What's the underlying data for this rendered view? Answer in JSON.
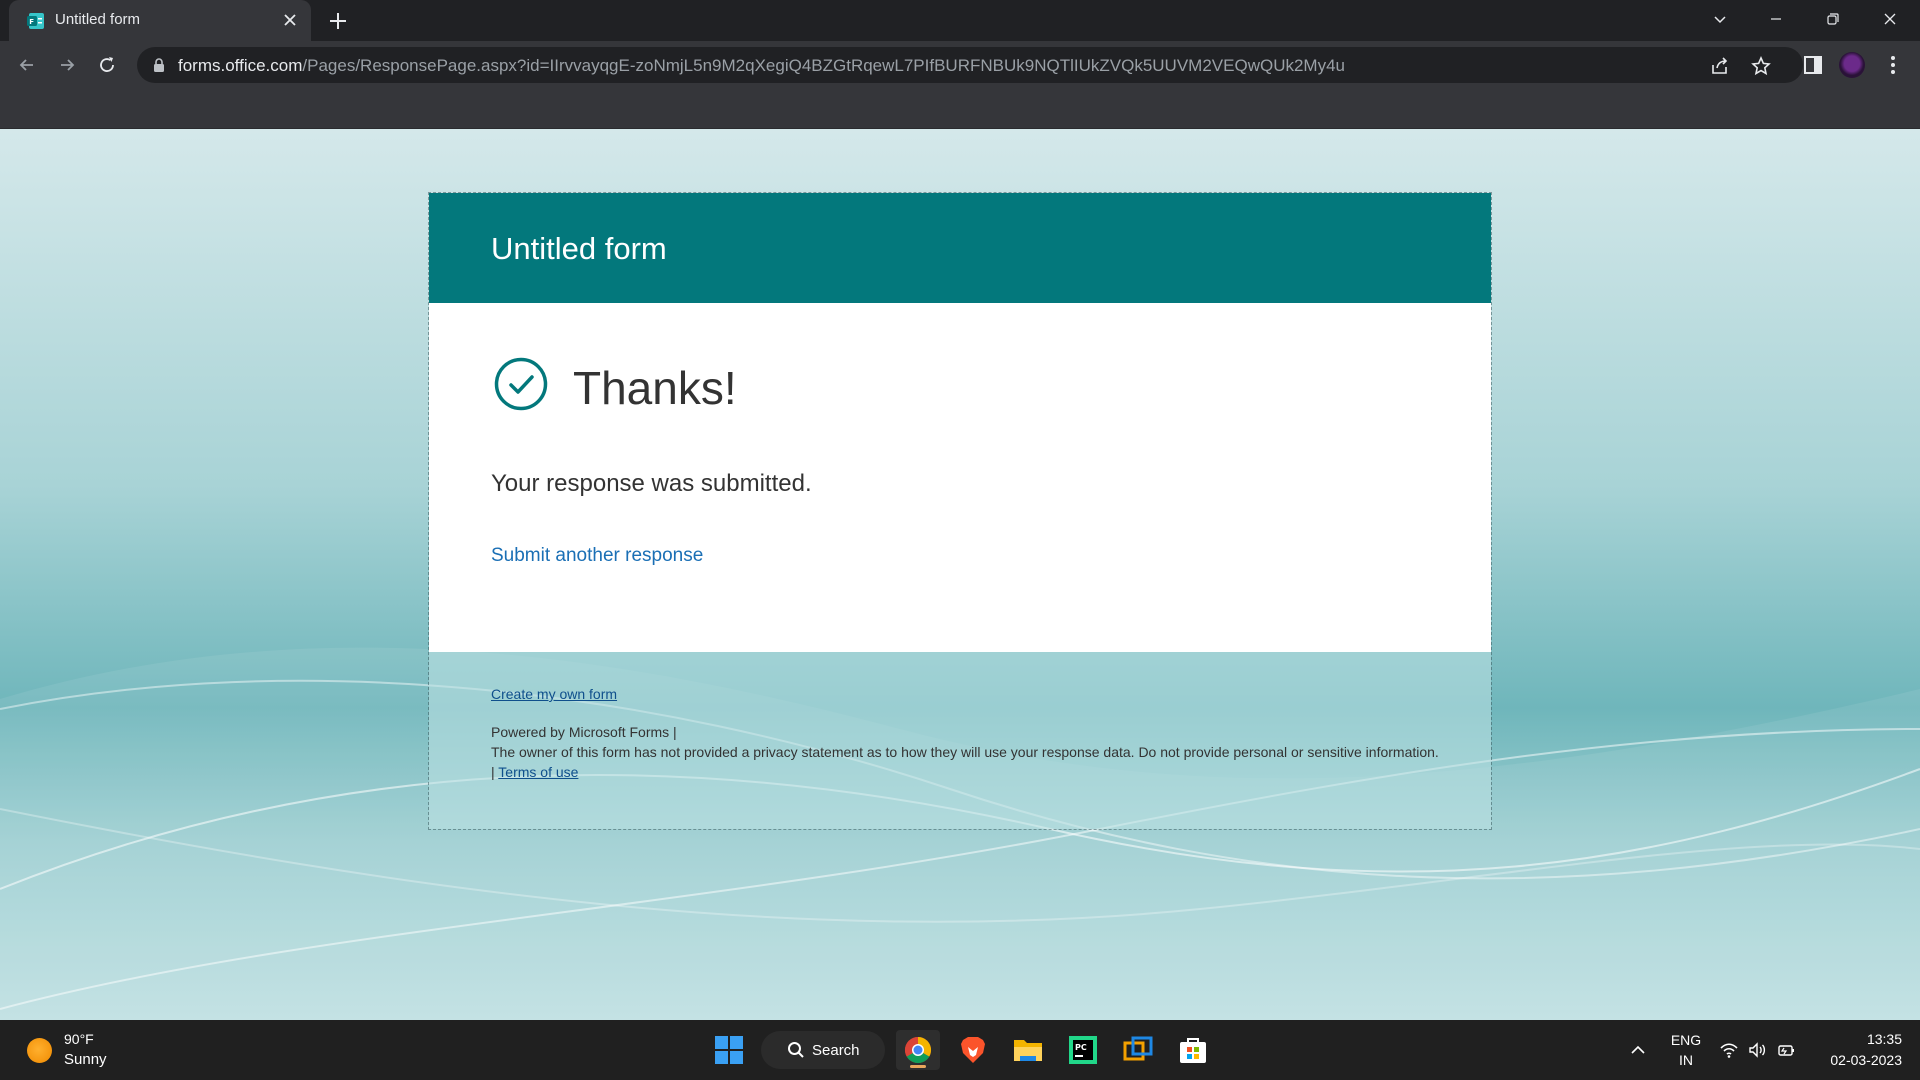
{
  "browser": {
    "tab_title": "Untitled form",
    "url_host": "forms.office.com",
    "url_path": "/Pages/ResponsePage.aspx?id=IIrvvayqgE-zoNmjL5n9M2qXegiQ4BZGtRqewL7PIfBURFNBUk9NQTlIUkZVQk5UUVM2VEQwQUk2My4u"
  },
  "form": {
    "title": "Untitled form",
    "thanks": "Thanks!",
    "submitted_message": "Your response was submitted.",
    "submit_another": "Submit another response",
    "create_own": "Create my own form",
    "powered_by": "Powered by Microsoft Forms |",
    "privacy_notice": "The owner of this form has not provided a privacy statement as to how they will use your response data. Do not provide personal or sensitive information.",
    "terms_prefix": "|",
    "terms": "Terms of use"
  },
  "taskbar": {
    "weather_temp": "90°F",
    "weather_desc": "Sunny",
    "search_label": "Search",
    "lang_top": "ENG",
    "lang_bottom": "IN",
    "time": "13:35",
    "date": "02-03-2023"
  },
  "colors": {
    "header": "#03787c",
    "link": "#1a6fb5"
  }
}
